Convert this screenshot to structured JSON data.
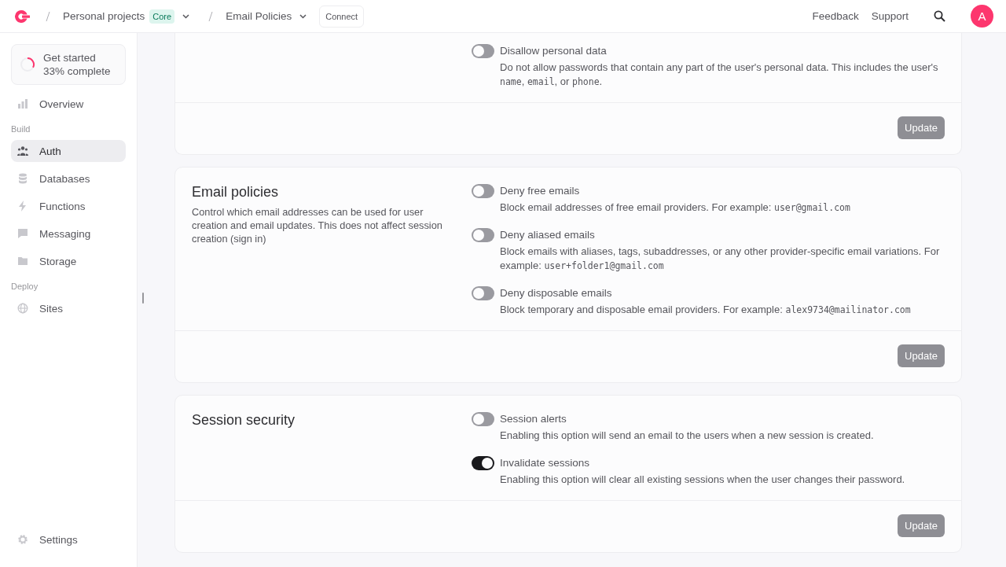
{
  "header": {
    "breadcrumbs": [
      {
        "label": "Personal projects",
        "badge": "Core"
      },
      {
        "label": "Email Policies"
      }
    ],
    "connect_button": "Connect",
    "links": [
      "Feedback",
      "Support"
    ],
    "avatar": "A"
  },
  "sidebar": {
    "progress": {
      "title": "Get started",
      "subtitle": "33% complete",
      "level": 0.33
    },
    "groups": [
      {
        "items": [
          {
            "label": "Overview",
            "selected": false
          }
        ]
      },
      {
        "heading": "Build",
        "items": [
          {
            "label": "Auth",
            "selected": true
          },
          {
            "label": "Databases",
            "selected": false
          },
          {
            "label": "Functions",
            "selected": false
          },
          {
            "label": "Messaging",
            "selected": false
          },
          {
            "label": "Storage",
            "selected": false
          }
        ]
      },
      {
        "heading": "Deploy",
        "items": [
          {
            "label": "Sites",
            "selected": false
          }
        ]
      }
    ],
    "footer_item": {
      "label": "Settings",
      "selected": false
    }
  },
  "sections": [
    {
      "cut_top": true,
      "options": [
        {
          "label": "Disallow personal data",
          "on": false,
          "description": [
            {
              "text": "Do not allow passwords that contain any part of the user's personal data. This includes the user's "
            },
            {
              "text": "name",
              "code": true
            },
            {
              "text": ", "
            },
            {
              "text": "email",
              "code": true
            },
            {
              "text": ", or "
            },
            {
              "text": "phone",
              "code": true
            },
            {
              "text": "."
            }
          ]
        }
      ],
      "button": "Update"
    },
    {
      "title": "Email policies",
      "description": "Control which email addresses can be used for user creation and email updates. This does not affect session creation (sign in)",
      "options": [
        {
          "label": "Deny free emails",
          "on": false,
          "description": [
            {
              "text": "Block email addresses of free email providers. For example: "
            },
            {
              "text": "user@gmail.com",
              "code": true
            }
          ]
        },
        {
          "label": "Deny aliased emails",
          "on": false,
          "description": [
            {
              "text": "Block emails with aliases, tags, subaddresses, or any other provider-specific email variations. For example: "
            },
            {
              "text": "user+folder1@gmail.com",
              "code": true
            }
          ]
        },
        {
          "label": "Deny disposable emails",
          "on": false,
          "description": [
            {
              "text": "Block temporary and disposable email providers. For example: "
            },
            {
              "text": "alex9734@mailinator.com",
              "code": true
            }
          ]
        }
      ],
      "button": "Update"
    },
    {
      "title": "Session security",
      "options": [
        {
          "label": "Session alerts",
          "on": false,
          "description": [
            {
              "text": "Enabling this option will send an email to the users when a new session is created."
            }
          ]
        },
        {
          "label": "Invalidate sessions",
          "on": true,
          "description": [
            {
              "text": "Enabling this option will clear all existing sessions when the user changes their password."
            }
          ]
        }
      ],
      "button": "Update"
    }
  ]
}
